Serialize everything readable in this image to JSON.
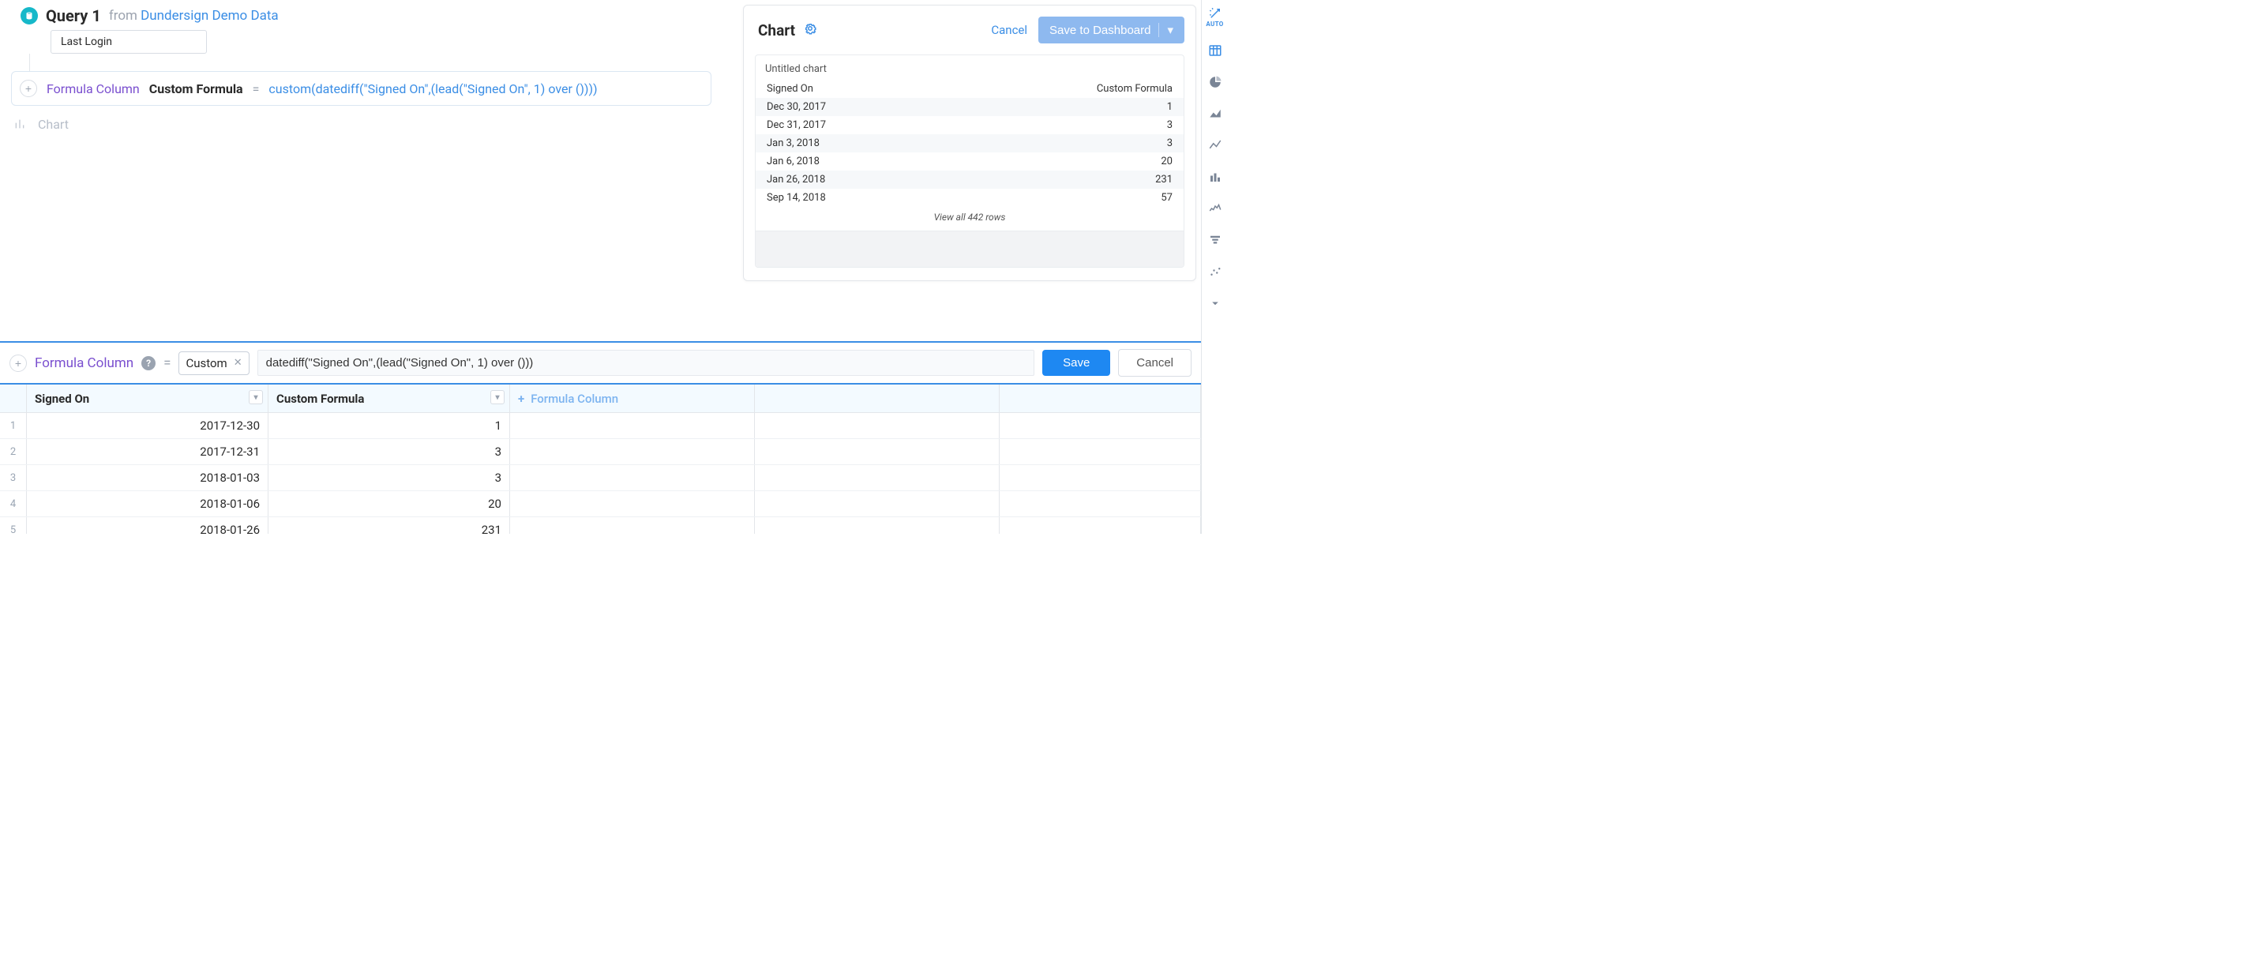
{
  "query": {
    "title": "Query 1",
    "from_label": "from",
    "datasource": "Dundersign Demo Data"
  },
  "tag": {
    "label": "Last Login"
  },
  "step": {
    "type_label": "Formula Column",
    "name": "Custom Formula",
    "eq": "=",
    "expression": "custom(datediff(\"Signed On\",(lead(\"Signed On\", 1) over ())))"
  },
  "chart_step": {
    "label": "Chart"
  },
  "chart_panel": {
    "title": "Chart",
    "cancel": "Cancel",
    "save": "Save to Dashboard",
    "untitled": "Untitled chart",
    "col_left": "Signed On",
    "col_right": "Custom Formula",
    "view_all": "View all 442 rows"
  },
  "chart_data": {
    "type": "table",
    "columns": [
      "Signed On",
      "Custom Formula"
    ],
    "rows": [
      {
        "signed_on": "Dec 30, 2017",
        "value": 1
      },
      {
        "signed_on": "Dec 31, 2017",
        "value": 3
      },
      {
        "signed_on": "Jan 3, 2018",
        "value": 3
      },
      {
        "signed_on": "Jan 6, 2018",
        "value": 20
      },
      {
        "signed_on": "Jan 26, 2018",
        "value": 231
      },
      {
        "signed_on": "Sep 14, 2018",
        "value": 57
      }
    ],
    "total_rows": 442
  },
  "formula_bar": {
    "label": "Formula Column",
    "help": "?",
    "eq": "=",
    "chip": "Custom",
    "expression": "datediff(\"Signed On\",(lead(\"Signed On\", 1) over ()))",
    "save": "Save",
    "cancel": "Cancel"
  },
  "table": {
    "headers": {
      "signed_on": "Signed On",
      "formula": "Custom Formula",
      "add": "Formula Column"
    },
    "rows": [
      {
        "n": 1,
        "signed_on": "2017-12-30",
        "value": 1
      },
      {
        "n": 2,
        "signed_on": "2017-12-31",
        "value": 3
      },
      {
        "n": 3,
        "signed_on": "2018-01-03",
        "value": 3
      },
      {
        "n": 4,
        "signed_on": "2018-01-06",
        "value": 20
      },
      {
        "n": 5,
        "signed_on": "2018-01-26",
        "value": 231
      }
    ]
  },
  "rail": {
    "auto": "AUTO"
  }
}
